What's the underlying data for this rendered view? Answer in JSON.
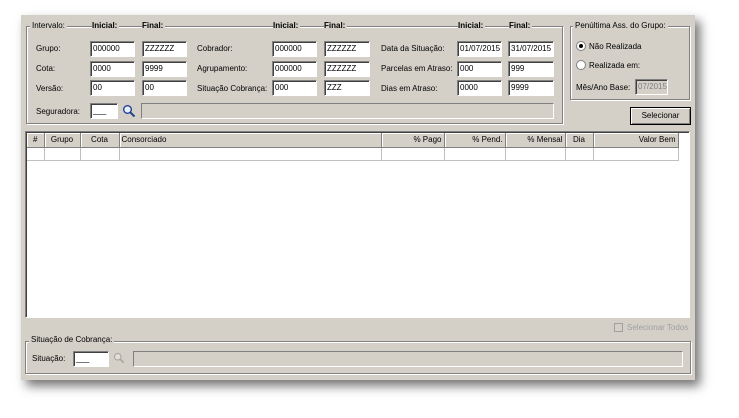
{
  "filters": {
    "interval_label": "Intervalo:",
    "inicial_header": "Inicial:",
    "final_header": "Final:",
    "col1": {
      "grupo": {
        "label": "Grupo:",
        "from": "000000",
        "to": "ZZZZZZ"
      },
      "cota": {
        "label": "Cota:",
        "from": "0000",
        "to": "9999"
      },
      "versao": {
        "label": "Versão:",
        "from": "00",
        "to": "00"
      }
    },
    "col2": {
      "cobrador": {
        "label": "Cobrador:",
        "from": "000000",
        "to": "ZZZZZZ"
      },
      "agrupamento": {
        "label": "Agrupamento:",
        "from": "000000",
        "to": "ZZZZZZ"
      },
      "situacao_cobranca": {
        "label": "Situação Cobrança:",
        "from": "000",
        "to": "ZZZ"
      }
    },
    "col3": {
      "data_situacao": {
        "label": "Data da Situação:",
        "from": "01/07/2015",
        "to": "31/07/2015"
      },
      "parcelas_atraso": {
        "label": "Parcelas em Atraso:",
        "from": "000",
        "to": "999"
      },
      "dias_atraso": {
        "label": "Dias em Atraso:",
        "from": "0000",
        "to": "9999"
      }
    },
    "seguradora": {
      "label": "Seguradora:",
      "value": "___",
      "description": ""
    }
  },
  "penultima": {
    "title": "Penúltima Ass. do Grupo:",
    "options": [
      "Não Realizada",
      "Realizada em:"
    ],
    "selected": "Não Realizada",
    "mes_ano_label": "Mês/Ano Base:",
    "mes_ano_value": "07/2015"
  },
  "selecionar_button": "Selecionar",
  "grid": {
    "columns": [
      {
        "label": "#",
        "align": "center"
      },
      {
        "label": "Grupo",
        "align": "center"
      },
      {
        "label": "Cota",
        "align": "center"
      },
      {
        "label": "Consorciado",
        "align": "left"
      },
      {
        "label": "% Pago",
        "align": "right"
      },
      {
        "label": "% Pend.",
        "align": "right"
      },
      {
        "label": "% Mensal",
        "align": "right"
      },
      {
        "label": "Dia",
        "align": "center"
      },
      {
        "label": "Valor Bem",
        "align": "right"
      }
    ]
  },
  "selecionar_todos": "Selecionar Todos",
  "situacao_cobranca_box": {
    "title": "Situação de Cobrança:",
    "label": "Situação:",
    "value": "___",
    "description": ""
  },
  "icons": {
    "search": "magnifier-icon"
  }
}
